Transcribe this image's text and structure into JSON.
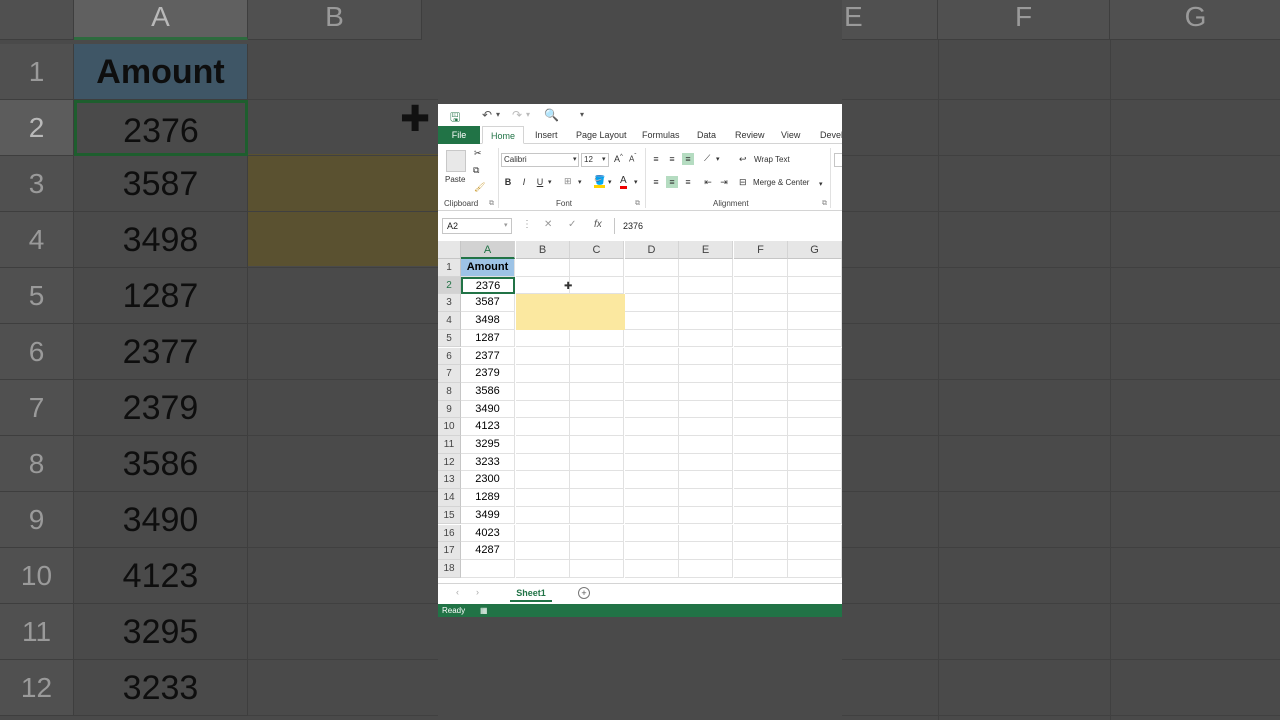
{
  "background": {
    "col_headers": [
      "A",
      "B",
      "E",
      "F",
      "G"
    ],
    "rows": [
      "1",
      "2",
      "3",
      "4",
      "5",
      "6",
      "7",
      "8",
      "9",
      "10",
      "11",
      "12"
    ],
    "values": [
      "Amount",
      "2376",
      "3587",
      "3498",
      "1287",
      "2377",
      "2379",
      "3586",
      "3490",
      "4123",
      "3295",
      "3233"
    ]
  },
  "tabs": {
    "file": "File",
    "home": "Home",
    "insert": "Insert",
    "page_layout": "Page Layout",
    "formulas": "Formulas",
    "data": "Data",
    "review": "Review",
    "view": "View",
    "developer": "Develo"
  },
  "ribbon": {
    "paste": "Paste",
    "font_name": "Calibri",
    "font_size": "12",
    "bold": "B",
    "italic": "I",
    "underline": "U",
    "wrap_text": "Wrap Text",
    "merge_center": "Merge & Center",
    "clipboard": "Clipboard",
    "font": "Font",
    "alignment": "Alignment"
  },
  "formula_bar": {
    "name_box": "A2",
    "fx": "fx",
    "value": "2376"
  },
  "grid": {
    "columns": [
      "A",
      "B",
      "C",
      "D",
      "E",
      "F",
      "G"
    ],
    "rows": [
      "1",
      "2",
      "3",
      "4",
      "5",
      "6",
      "7",
      "8",
      "9",
      "10",
      "11",
      "12",
      "13",
      "14",
      "15",
      "16",
      "17",
      "18"
    ],
    "header": "Amount",
    "values": [
      "2376",
      "3587",
      "3498",
      "1287",
      "2377",
      "2379",
      "3586",
      "3490",
      "4123",
      "3295",
      "3233",
      "2300",
      "1289",
      "3499",
      "4023",
      "4287"
    ]
  },
  "sheet_tab": "Sheet1",
  "status": "Ready",
  "colors": {
    "excel_green": "#217346",
    "header_fill": "#9dc3e6",
    "highlight_fill": "#fbe8a0"
  }
}
